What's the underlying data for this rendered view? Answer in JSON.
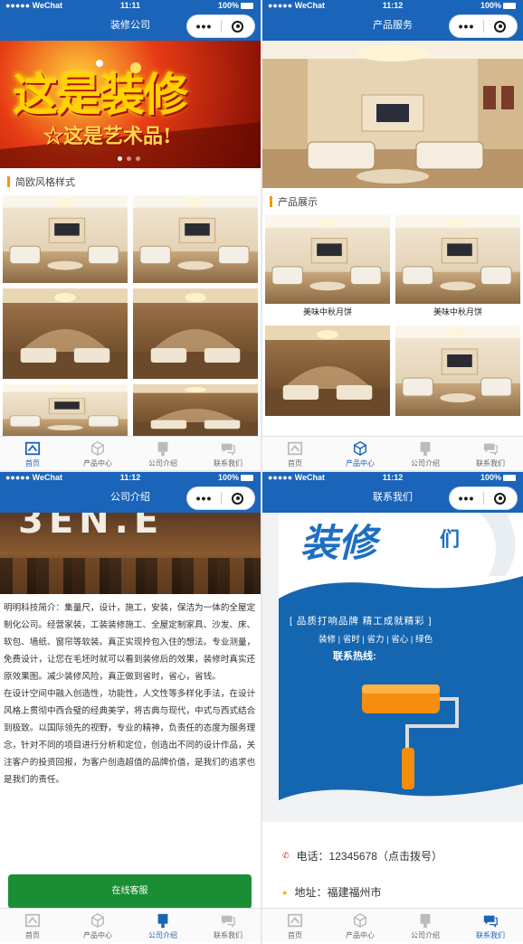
{
  "status": {
    "signal": "●●●●● WeChat",
    "battery": "100%",
    "time_1": "11:11",
    "time_2": "11:12",
    "time_3": "11:12",
    "time_4": "11:12"
  },
  "capsule": {
    "more": "•••"
  },
  "panel1": {
    "title": "装修公司",
    "banner_main": "这是装修",
    "banner_sub": "☆这是艺术品!",
    "section_title": "简欧风格样式"
  },
  "panel2": {
    "title": "产品服务",
    "section_title": "产品展示",
    "captions": [
      "美味中秋月饼",
      "美味中秋月饼"
    ]
  },
  "panel3": {
    "title": "公司介绍",
    "banner_text": "3EN.E",
    "intro_paragraphs": [
      "明明科技简介：集量尺，设计，施工，安装，保洁为一体的全屋定制化公司。经营家装，工装装修施工、全屋定制家具、沙发、床、软包、墙纸、窗帘等软装。真正实现拎包入住的想法。专业测量，免费设计，让您在毛坯时就可以看到装修后的效果，装修时真实还原效果图。减少装修风险，真正做到省时，省心，省钱。",
      "在设计空间中融入创造性，功能性，人文性等多样化手法，在设计风格上贯彻中西合璧的经典美学，将古典与现代，中式与西式结合到极致。以国际领先的视野，专业的精神，负责任的态度为服务理念，针对不同的项目进行分析和定位，创造出不同的设计作品，关注客户的投资回报，为客户创造超值的品牌价值，是我们的追求也是我们的责任。"
    ],
    "button": "在线客服"
  },
  "panel4": {
    "title": "联系我们",
    "poster_brush": "装修",
    "poster_top": "们",
    "poster_slogan": "[ 品质打响品牌  精工成就精彩 ]",
    "poster_tags": "装修 | 省时 | 省力 | 省心 | 绿色",
    "poster_hotline": "联系热线:",
    "phone": "电话：12345678（点击拨号）",
    "address": "地址：福建福州市"
  },
  "tabs": [
    "首页",
    "产品中心",
    "公司介绍",
    "联系我们"
  ],
  "colors": {
    "brand_blue": "#1a64b9",
    "accent_orange": "#f39800",
    "button_green": "#1b8e35"
  },
  "icons": {
    "home": "home-icon",
    "product": "cube-icon",
    "company": "building-icon",
    "contact": "chat-icon"
  }
}
